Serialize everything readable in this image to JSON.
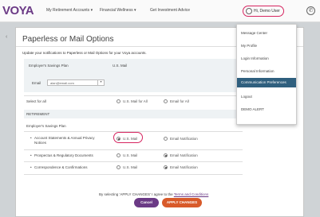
{
  "header": {
    "logo": "VOYA",
    "nav": [
      "My Retirement Accounts",
      "Financial Wellness",
      "Get Investment Advice"
    ],
    "nav_caret": "▾",
    "user": "Hi, Demo User",
    "phone_glyph": "✆"
  },
  "page": {
    "back_glyph": "‹",
    "title": "Paperless or Mail Options",
    "instructions": "Update your notifications to Paperless or Mail Options for your Voya accounts."
  },
  "account": {
    "plan_label": "Employer's Savings Plan",
    "plan_value": "U.S. Mail",
    "email_label": "Email",
    "email_value": "alan@email.com",
    "email_caret": "▾"
  },
  "select_all": {
    "label": "Select for all",
    "opt_mail": "U.S. Mail for All",
    "opt_email": "Email for All"
  },
  "section": "RETIREMENT",
  "plan_heading": "Employer's Savings Plan",
  "rows": [
    {
      "bullet": "•",
      "label": "Account Statements & Annual Privacy",
      "label2": "Notices",
      "opt_mail": "U.S. Mail",
      "opt_email": "Email Notification",
      "selected": "mail"
    },
    {
      "bullet": "•",
      "label": "Prospectus & Regulatory Documents",
      "label2": "",
      "opt_mail": "U.S. Mail",
      "opt_email": "Email Notification",
      "selected": "email"
    },
    {
      "bullet": "•",
      "label": "Correspondence & Confirmations",
      "label2": "",
      "opt_mail": "U.S. Mail",
      "opt_email": "Email Notification",
      "selected": "email"
    }
  ],
  "consent": {
    "text": "By selecting 'APPLY CHANGES' I agree to the",
    "link": "Terms and Conditions"
  },
  "buttons": {
    "cancel": "Cancel",
    "apply": "APPLY CHANGES"
  },
  "menu": {
    "items": [
      "Message Center",
      "My Profile",
      "Login Information",
      "Personal Information",
      "Communication Preferences",
      "Logout",
      "DEMO ALERT"
    ],
    "active_index": 4
  },
  "colors": {
    "brand": "#6b3a86",
    "highlight": "#d6245f",
    "menu_active": "#2f5f7e",
    "cancel_btn": "#6b3a86",
    "apply_btn": "#d85a2a"
  }
}
